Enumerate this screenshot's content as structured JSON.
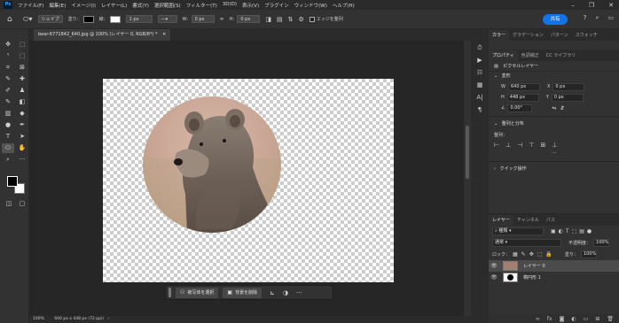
{
  "app": {
    "logo": "Ps"
  },
  "menu": [
    "ファイル(F)",
    "編集(E)",
    "イメージ(I)",
    "レイヤー(L)",
    "書式(Y)",
    "選択範囲(S)",
    "フィルター(T)",
    "3D(D)",
    "表示(V)",
    "プラグイン",
    "ウィンドウ(W)",
    "ヘルプ(H)"
  ],
  "options": {
    "mode": "シェイプ",
    "fill_label": "塗り：",
    "stroke_label": "線：",
    "stroke_width": "1 px",
    "w_label": "W：",
    "w_value": "0 px",
    "h_label": "H：",
    "h_value": "0 px",
    "align_edges": "エッジを整列",
    "share": "共有"
  },
  "document": {
    "tab": "bear-6771842_640.jpg @ 100% (レイヤー 0, RGB/8*) *",
    "zoom": "100%",
    "size": "640 px x 448 px (72 ppi)"
  },
  "context_bar": {
    "select_subject": "被写体を選択",
    "remove_bg": "背景を削除"
  },
  "panel_tabs_top": [
    "カラー",
    "グラデーション",
    "パターン",
    "スウォッチ"
  ],
  "panel_tabs_props": [
    "プロパティ",
    "色調補正",
    "CC ライブラリ"
  ],
  "properties": {
    "layer_type": "ピクセルレイヤー",
    "transform": "変形",
    "w_label": "W",
    "w": "640 px",
    "h_label": "H",
    "h": "448 px",
    "x_label": "X",
    "x": "0 px",
    "y_label": "Y",
    "y": "0 px",
    "angle": "0.00°",
    "align_section": "整列と分布",
    "align_label": "整列：",
    "quick_actions": "クイック操作"
  },
  "layers_panel": {
    "tabs": [
      "レイヤー",
      "チャンネル",
      "パス"
    ],
    "filter_kind": "種類",
    "blend_mode": "通常",
    "opacity_label": "不透明度：",
    "opacity": "100%",
    "lock_label": "ロック：",
    "fill_label": "塗り：",
    "fill": "100%",
    "layers": [
      {
        "name": "レイヤー 0",
        "selected": true
      },
      {
        "name": "楕円形 1",
        "selected": false
      }
    ]
  }
}
